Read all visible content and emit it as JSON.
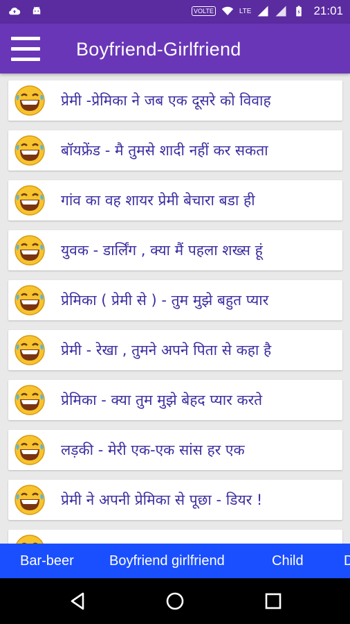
{
  "status_bar": {
    "time": "21:01",
    "volte": "VOLTE",
    "network": "LTE",
    "icons": [
      "cloud-upload-icon",
      "android-icon",
      "wifi-icon",
      "signal-icon",
      "signal-icon",
      "battery-icon"
    ]
  },
  "app_bar": {
    "title": "Boyfriend-Girlfriend",
    "menu_icon": "hamburger-menu-icon"
  },
  "list": {
    "items": [
      {
        "text": "प्रेमी -प्रेमिका ने जब एक दूसरे को विवाह"
      },
      {
        "text": "बॉयफ्रेंड - मै तुमसे शादी नहीं कर सकता"
      },
      {
        "text": "गांव का वह शायर प्रेमी बेचारा बडा ही"
      },
      {
        "text": "युवक - डार्लिंग , क्या मैं पहला शख्स हूं"
      },
      {
        "text": "प्रेमिका ( प्रेमी से ) - तुम मुझे बहुत प्यार"
      },
      {
        "text": "प्रेमी - रेखा , तुमने अपने पिता से कहा है"
      },
      {
        "text": "प्रेमिका - क्या तुम मुझे बेहद प्यार करते"
      },
      {
        "text": "लड़की - मेरी एक-एक सांस हर एक"
      },
      {
        "text": "प्रेमी ने अपनी प्रेमिका से पूछा - डियर !"
      },
      {
        "text": ""
      }
    ],
    "emoji_icon": "laughing-emoji-icon"
  },
  "tabs": [
    {
      "label": "Bar-beer"
    },
    {
      "label": "Boyfriend girlfriend"
    },
    {
      "label": "Child"
    },
    {
      "label": "D"
    }
  ],
  "nav_bar": {
    "icons": [
      "back-icon",
      "home-icon",
      "recents-icon"
    ]
  },
  "colors": {
    "status_bar": "#5b2ba0",
    "app_bar": "#6a36b8",
    "tab_bar": "#1a4fff",
    "item_text": "#3b2ea0"
  }
}
